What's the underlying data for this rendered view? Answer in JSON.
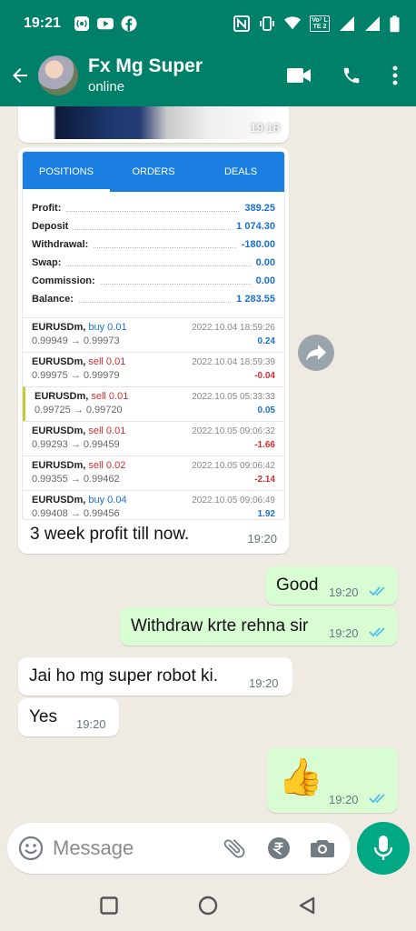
{
  "status_bar": {
    "time": "19:21",
    "icons_left": [
      "hotspot-icon",
      "youtube-icon",
      "facebook-icon"
    ],
    "icons_right": [
      "nfc-icon",
      "vibrate-icon",
      "wifi-icon",
      "volte-icon",
      "signal-icon",
      "signal-icon",
      "battery-icon"
    ],
    "volte_label": "Vo⁷ LTE 2"
  },
  "header": {
    "contact_name": "Fx Mg Super",
    "status": "online"
  },
  "colors": {
    "header_bg": "#008069",
    "outgoing_bubble": "#d9fdd3",
    "chat_bg": "#efeae2",
    "read_ticks": "#53bdeb",
    "mic_button": "#00a884"
  },
  "messages": [
    {
      "id": "prev-image",
      "direction": "in",
      "type": "image",
      "time": "19:18"
    },
    {
      "id": "trade-report",
      "direction": "in",
      "type": "image-with-caption",
      "caption": "3 week profit till now.",
      "time": "19:20",
      "screenshot": {
        "tabs": [
          "POSITIONS",
          "ORDERS",
          "DEALS"
        ],
        "active_tab": "POSITIONS",
        "summary": [
          {
            "label": "Profit:",
            "value": "389.25"
          },
          {
            "label": "Deposit",
            "value": "1 074.30"
          },
          {
            "label": "Withdrawal:",
            "value": "-180.00"
          },
          {
            "label": "Swap:",
            "value": "0.00"
          },
          {
            "label": "Commission:",
            "value": "0.00"
          },
          {
            "label": "Balance:",
            "value": "1 283.55"
          }
        ],
        "deals": [
          {
            "symbol": "EURUSDm,",
            "side": "buy",
            "side_text": "buy 0.01",
            "prices": "0.99949 → 0.99973",
            "date": "2022.10.04 18:59:26",
            "profit": "0.24"
          },
          {
            "symbol": "EURUSDm,",
            "side": "sell",
            "side_text": "sell 0.01",
            "prices": "0.99975 → 0.99979",
            "date": "2022.10.04 18:59:39",
            "profit": "-0.04"
          },
          {
            "symbol": "EURUSDm,",
            "side": "sell",
            "side_text": "sell 0.01",
            "prices": "0.99725 → 0.99720",
            "date": "2022.10.05 05:33:33",
            "profit": "0.05"
          },
          {
            "symbol": "EURUSDm,",
            "side": "sell",
            "side_text": "sell 0.01",
            "prices": "0.99293 → 0.99459",
            "date": "2022.10.05 09:06:32",
            "profit": "-1.66"
          },
          {
            "symbol": "EURUSDm,",
            "side": "sell",
            "side_text": "sell 0.02",
            "prices": "0.99355 → 0.99462",
            "date": "2022.10.05 09:06:42",
            "profit": "-2.14"
          },
          {
            "symbol": "EURUSDm,",
            "side": "buy",
            "side_text": "buy 0.04",
            "prices": "0.99408 → 0.99456",
            "date": "2022.10.05 09:06:49",
            "profit": "1.92"
          }
        ]
      }
    },
    {
      "id": "good",
      "direction": "out",
      "text": "Good",
      "time": "19:20",
      "read": true
    },
    {
      "id": "withdraw",
      "direction": "out",
      "text": "Withdraw krte rehna sir",
      "time": "19:20",
      "read": true
    },
    {
      "id": "jai-ho",
      "direction": "in",
      "text": "Jai ho mg super robot ki.",
      "time": "19:20"
    },
    {
      "id": "yes",
      "direction": "in",
      "text": "Yes",
      "time": "19:20"
    },
    {
      "id": "thumbs",
      "direction": "out",
      "text": "👍",
      "time": "19:20",
      "read": true
    }
  ],
  "composer": {
    "placeholder": "Message"
  }
}
